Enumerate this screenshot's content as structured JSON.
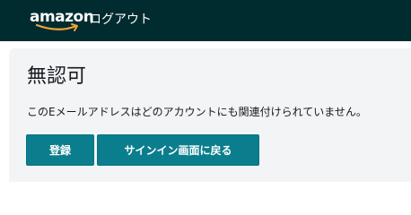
{
  "header": {
    "logo_text": "amazon",
    "title": "ログアウト",
    "background": "#002b2f",
    "logo_accent": "#f2a33a"
  },
  "main": {
    "title": "無認可",
    "message": "このEメールアドレスはどのアカウントにも関連付けられていません。",
    "buttons": {
      "register_label": "登録",
      "back_to_signin_label": "サインイン画面に戻る"
    },
    "button_color": "#0a7e8c"
  }
}
